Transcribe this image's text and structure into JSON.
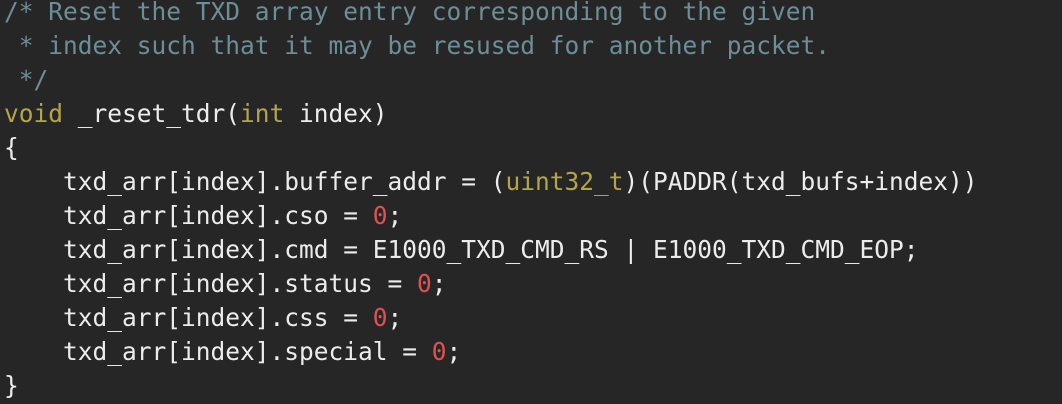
{
  "code": {
    "lines": [
      [
        {
          "text": "/* Reset the TXD array entry corresponding to the given",
          "kind": "comment"
        }
      ],
      [
        {
          "text": " * index such that it may be resused for another packet.",
          "kind": "comment"
        }
      ],
      [
        {
          "text": " */",
          "kind": "comment"
        }
      ],
      [
        {
          "text": "void",
          "kind": "type"
        },
        {
          "text": " _reset_tdr(",
          "kind": "plain"
        },
        {
          "text": "int",
          "kind": "type"
        },
        {
          "text": " index)",
          "kind": "plain"
        }
      ],
      [
        {
          "text": "{",
          "kind": "plain"
        }
      ],
      [
        {
          "text": "    txd_arr[index].buffer_addr = (",
          "kind": "plain"
        },
        {
          "text": "uint32_t",
          "kind": "type"
        },
        {
          "text": ")(PADDR(txd_bufs+index))",
          "kind": "plain"
        }
      ],
      [
        {
          "text": "    txd_arr[index].cso = ",
          "kind": "plain"
        },
        {
          "text": "0",
          "kind": "number"
        },
        {
          "text": ";",
          "kind": "plain"
        }
      ],
      [
        {
          "text": "    txd_arr[index].cmd = E1000_TXD_CMD_RS | E1000_TXD_CMD_EOP;",
          "kind": "plain"
        }
      ],
      [
        {
          "text": "    txd_arr[index].status = ",
          "kind": "plain"
        },
        {
          "text": "0",
          "kind": "number"
        },
        {
          "text": ";",
          "kind": "plain"
        }
      ],
      [
        {
          "text": "    txd_arr[index].css = ",
          "kind": "plain"
        },
        {
          "text": "0",
          "kind": "number"
        },
        {
          "text": ";",
          "kind": "plain"
        }
      ],
      [
        {
          "text": "    txd_arr[index].special = ",
          "kind": "plain"
        },
        {
          "text": "0",
          "kind": "number"
        },
        {
          "text": ";",
          "kind": "plain"
        }
      ],
      [
        {
          "text": "}",
          "kind": "plain"
        }
      ]
    ]
  },
  "colors": {
    "background": "#262626",
    "comment": "#6c8e97",
    "type": "#b4a647",
    "number": "#e0514f",
    "plain": "#ececec"
  }
}
